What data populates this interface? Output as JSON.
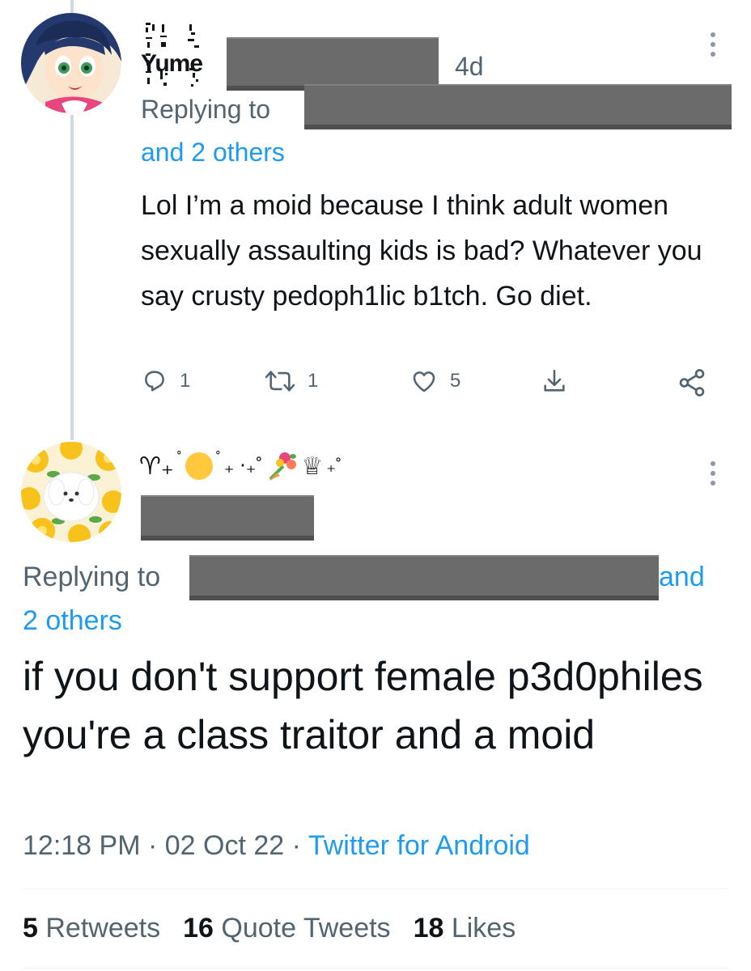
{
  "reply_tweet": {
    "display_name": "Yume",
    "timestamp": "4d",
    "replying_to_label": "Replying to",
    "others_label": "and 2 others",
    "text": "Lol I’m a moid because I think adult women sexually assaulting kids is bad? Whatever you say crusty pedoph1lic b1tch. Go diet.",
    "actions": {
      "reply_count": "1",
      "retweet_count": "1",
      "like_count": "5"
    }
  },
  "main_tweet": {
    "display_name_glyphs": [
      "♈︎₊",
      "˚",
      "˚",
      "₊ ‧₊˚",
      "♕",
      "₊˚"
    ],
    "replying_to_label": "Replying to",
    "and_label": "and",
    "others_label": "2 others",
    "text": "if you don't support female p3d0philes you're a class traitor and a moid",
    "time": "12:18 PM",
    "date": "02 Oct 22",
    "separator": "·",
    "source": "Twitter for Android",
    "stats": {
      "retweets_count": "5",
      "retweets_label": "Retweets",
      "quotes_count": "16",
      "quotes_label": "Quote Tweets",
      "likes_count": "18",
      "likes_label": "Likes"
    }
  },
  "colors": {
    "link_blue": "#1d9bf0",
    "secondary_gray": "#536471",
    "redaction_gray": "#6b6b6b"
  },
  "icons": {
    "reply": "reply-icon",
    "retweet": "retweet-icon",
    "like": "heart-icon",
    "download": "download-icon",
    "share": "share-icon",
    "more": "more-dots-icon"
  }
}
